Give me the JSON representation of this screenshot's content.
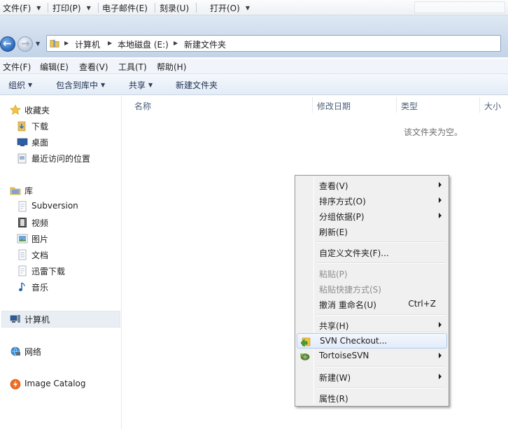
{
  "outer_menubar": {
    "items": [
      "文件(F)",
      "打印(P)",
      "电子邮件(E)",
      "刻录(U)",
      "打开(O)"
    ]
  },
  "address_bar": {
    "crumbs": [
      "计算机",
      "本地磁盘 (E:)",
      "新建文件夹"
    ]
  },
  "menubar": {
    "items": [
      "文件(F)",
      "编辑(E)",
      "查看(V)",
      "工具(T)",
      "帮助(H)"
    ]
  },
  "toolbar": {
    "items": [
      "组织",
      "包含到库中",
      "共享",
      "新建文件夹"
    ]
  },
  "nav_pane": {
    "favorites": {
      "label": "收藏夹",
      "items": [
        "下载",
        "桌面",
        "最近访问的位置"
      ]
    },
    "libraries": {
      "label": "库",
      "items": [
        "Subversion",
        "视频",
        "图片",
        "文档",
        "迅雷下载",
        "音乐"
      ]
    },
    "computer": "计算机",
    "network": "网络",
    "image_catalog": "Image Catalog"
  },
  "content": {
    "columns": [
      "名称",
      "修改日期",
      "类型",
      "大小"
    ],
    "empty_message": "该文件夹为空。"
  },
  "context_menu": {
    "view": "查看(V)",
    "sort": "排序方式(O)",
    "group": "分组依据(P)",
    "refresh": "刷新(E)",
    "customize": "自定义文件夹(F)...",
    "paste": "粘贴(P)",
    "paste_shortcut": "粘贴快捷方式(S)",
    "undo_rename": "撤消 重命名(U)",
    "undo_shortcut": "Ctrl+Z",
    "share": "共享(H)",
    "svn_checkout": "SVN Checkout...",
    "tortoise_svn": "TortoiseSVN",
    "new": "新建(W)",
    "properties": "属性(R)"
  }
}
